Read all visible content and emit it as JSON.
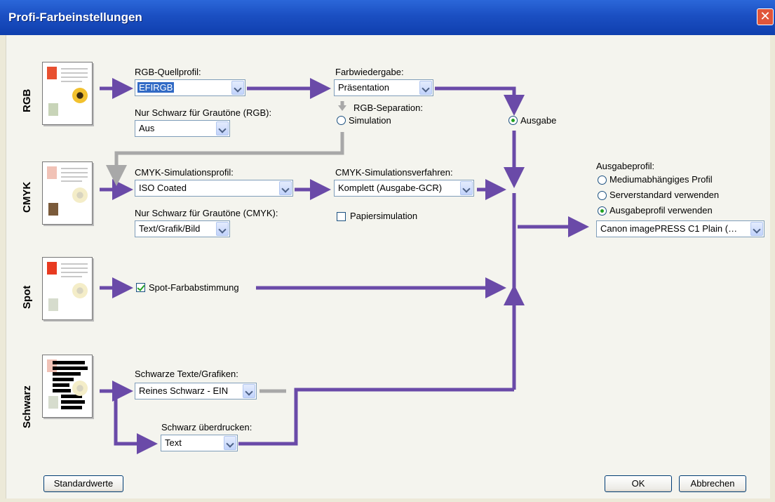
{
  "window": {
    "title": "Profi-Farbeinstellungen"
  },
  "rows": {
    "rgb": "RGB",
    "cmyk": "CMYK",
    "spot": "Spot",
    "schwarz": "Schwarz"
  },
  "rgb": {
    "source_profile_label": "RGB-Quellprofil:",
    "source_profile_value": "EFIRGB",
    "black_gray_label": "Nur Schwarz für Grautöne (RGB):",
    "black_gray_value": "Aus"
  },
  "rendering": {
    "label": "Farbwiedergabe:",
    "value": "Präsentation",
    "separation_label": "RGB-Separation:",
    "simulation_label": "Simulation",
    "output_label": "Ausgabe"
  },
  "cmyk": {
    "sim_profile_label": "CMYK-Simulationsprofil:",
    "sim_profile_value": "ISO Coated",
    "sim_method_label": "CMYK-Simulationsverfahren:",
    "sim_method_value": "Komplett (Ausgabe-GCR)",
    "paper_sim_label": "Papiersimulation",
    "black_gray_label": "Nur Schwarz für Grautöne (CMYK):",
    "black_gray_value": "Text/Grafik/Bild"
  },
  "spot": {
    "matching_label": "Spot-Farbabstimmung"
  },
  "schwarz": {
    "black_text_label": "Schwarze Texte/Grafiken:",
    "black_text_value": "Reines Schwarz - EIN",
    "overprint_label": "Schwarz überdrucken:",
    "overprint_value": "Text"
  },
  "output_profile": {
    "label": "Ausgabeprofil:",
    "option_media": "Mediumabhängiges Profil",
    "option_server": "Serverstandard verwenden",
    "option_output": "Ausgabeprofil verwenden",
    "value": "Canon imagePRESS C1 Plain (…"
  },
  "buttons": {
    "defaults": "Standardwerte",
    "ok": "OK",
    "cancel": "Abbrechen"
  },
  "colors": {
    "flow": "#6a4aa8",
    "flow_inactive": "#a8a8a8",
    "title_bar": "#1b4fc2",
    "selection": "#316ac5"
  }
}
